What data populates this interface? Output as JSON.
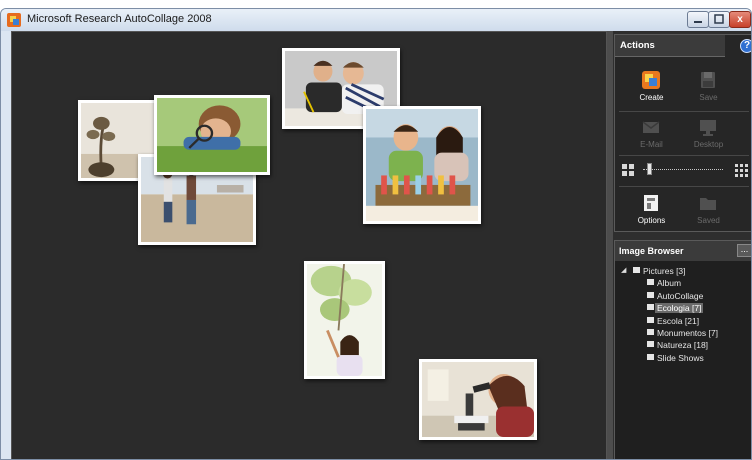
{
  "window": {
    "title": "Microsoft Research AutoCollage 2008",
    "controls": [
      "minimize",
      "maximize",
      "close"
    ],
    "close_glyph": "x"
  },
  "canvas": {
    "photos": [
      {
        "name": "photo-plant-seedling",
        "subject": "seedling-in-pot"
      },
      {
        "name": "photo-beach-children",
        "subject": "children-on-beach"
      },
      {
        "name": "photo-boy-magnifier",
        "subject": "boy-with-magnifying-glass"
      },
      {
        "name": "photo-boys-studying",
        "subject": "two-boys-writing"
      },
      {
        "name": "photo-kids-test-tubes",
        "subject": "children-with-test-tubes"
      },
      {
        "name": "photo-girl-tree",
        "subject": "girl-under-tree"
      },
      {
        "name": "photo-woman-microscope",
        "subject": "woman-at-microscope"
      }
    ]
  },
  "actions": {
    "heading": "Actions",
    "help_glyph": "?",
    "create_label": "Create",
    "save_label": "Save",
    "email_label": "E-Mail",
    "desktop_label": "Desktop",
    "options_label": "Options",
    "saved_label": "Saved",
    "icons": {
      "create": "create-icon",
      "save": "save-icon",
      "email": "email-icon",
      "desktop": "desktop-icon",
      "options": "options-icon",
      "saved": "saved-folder-icon"
    },
    "slider": {
      "level": 0.05,
      "min_icon": "small-grid-icon",
      "max_icon": "large-grid-icon"
    }
  },
  "browser": {
    "heading": "Image Browser",
    "more_label": "...",
    "tree": [
      {
        "label": "Pictures  [3]",
        "level": 0,
        "expanded": true,
        "selected": false
      },
      {
        "label": "Album",
        "level": 1,
        "selected": false
      },
      {
        "label": "AutoCollage",
        "level": 1,
        "selected": false
      },
      {
        "label": "Ecologia  [7]",
        "level": 1,
        "selected": true
      },
      {
        "label": "Escola  [21]",
        "level": 1,
        "selected": false
      },
      {
        "label": "Monumentos  [7]",
        "level": 1,
        "selected": false
      },
      {
        "label": "Natureza  [18]",
        "level": 1,
        "selected": false
      },
      {
        "label": "Slide Shows",
        "level": 1,
        "selected": false
      }
    ]
  },
  "colors": {
    "canvas_bg": "#2b2b2b",
    "panel_bg": "#262626",
    "title_bar": "#dce6f2",
    "accent_create": "#e8781e",
    "selection": "#6a6a6a"
  }
}
